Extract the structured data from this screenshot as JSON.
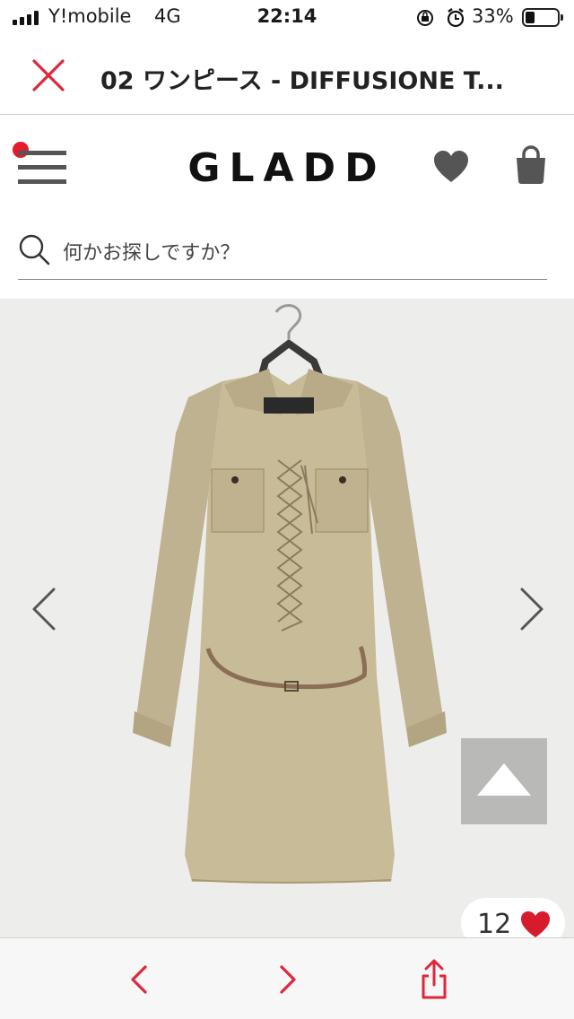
{
  "status_bar": {
    "carrier": "Y!mobile",
    "network": "4G",
    "time": "22:14",
    "battery_percent": "33%",
    "battery_level": 0.33
  },
  "tab": {
    "title": "02 ワンピース - DIFFUSIONE T..."
  },
  "header": {
    "logo": "GLADD",
    "menu_badge_color": "#e8192c"
  },
  "search": {
    "placeholder": "何かお探しですか？"
  },
  "product": {
    "like_count": "12",
    "like_color": "#d81b2c"
  },
  "icons": {
    "close": "close-icon",
    "menu": "hamburger-menu-icon",
    "favorites": "heart-icon",
    "cart": "shopping-bag-icon",
    "search": "search-icon",
    "prev_image": "chevron-left-icon",
    "next_image": "chevron-right-icon",
    "scroll_top": "triangle-up-icon",
    "browser_back": "chevron-left-icon",
    "browser_forward": "chevron-right-icon",
    "share": "share-icon"
  },
  "colors": {
    "accent_red": "#e8192c",
    "toolbar_icon": "#e0263a"
  }
}
